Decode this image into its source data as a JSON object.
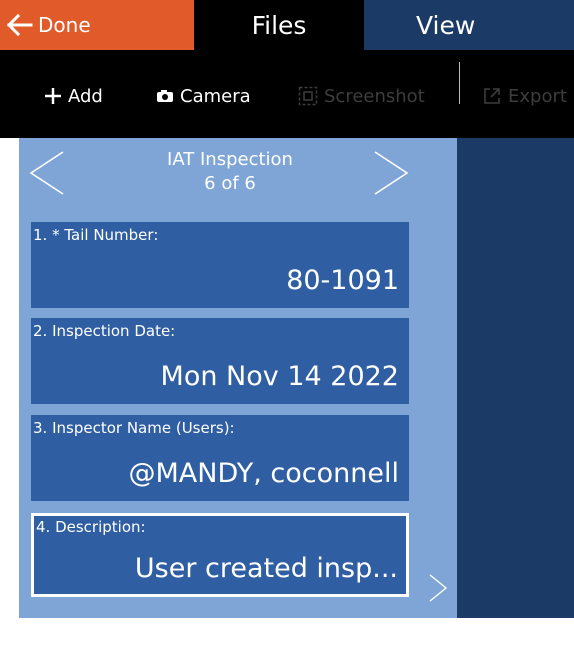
{
  "tabs": {
    "done_label": "Done",
    "files_label": "Files",
    "view_label": "View"
  },
  "toolbar": {
    "add_label": "Add",
    "camera_label": "Camera",
    "screenshot_label": "Screenshot",
    "export_label": "Export"
  },
  "inspection": {
    "title": "IAT Inspection",
    "position": "6 of 6"
  },
  "fields": [
    {
      "label": "1. * Tail Number:",
      "value": "80-1091"
    },
    {
      "label": "2. Inspection Date:",
      "value": "Mon Nov 14 2022"
    },
    {
      "label": "3. Inspector Name (Users):",
      "value": "@MANDY, coconnell"
    },
    {
      "label": "4. Description:",
      "value": "User created insp..."
    }
  ],
  "colors": {
    "done_tab": "#e15a2a",
    "view_tab": "#1b3a66",
    "panel_bg": "#7ea5d6",
    "card_bg": "#2f5ea2",
    "toolbar_bg": "#000000"
  },
  "icons": {
    "done": "arrow-left-icon",
    "add": "plus-icon",
    "camera": "camera-icon",
    "screenshot": "screenshot-icon",
    "export": "export-icon",
    "prev": "chevron-left-icon",
    "next": "chevron-right-icon"
  }
}
